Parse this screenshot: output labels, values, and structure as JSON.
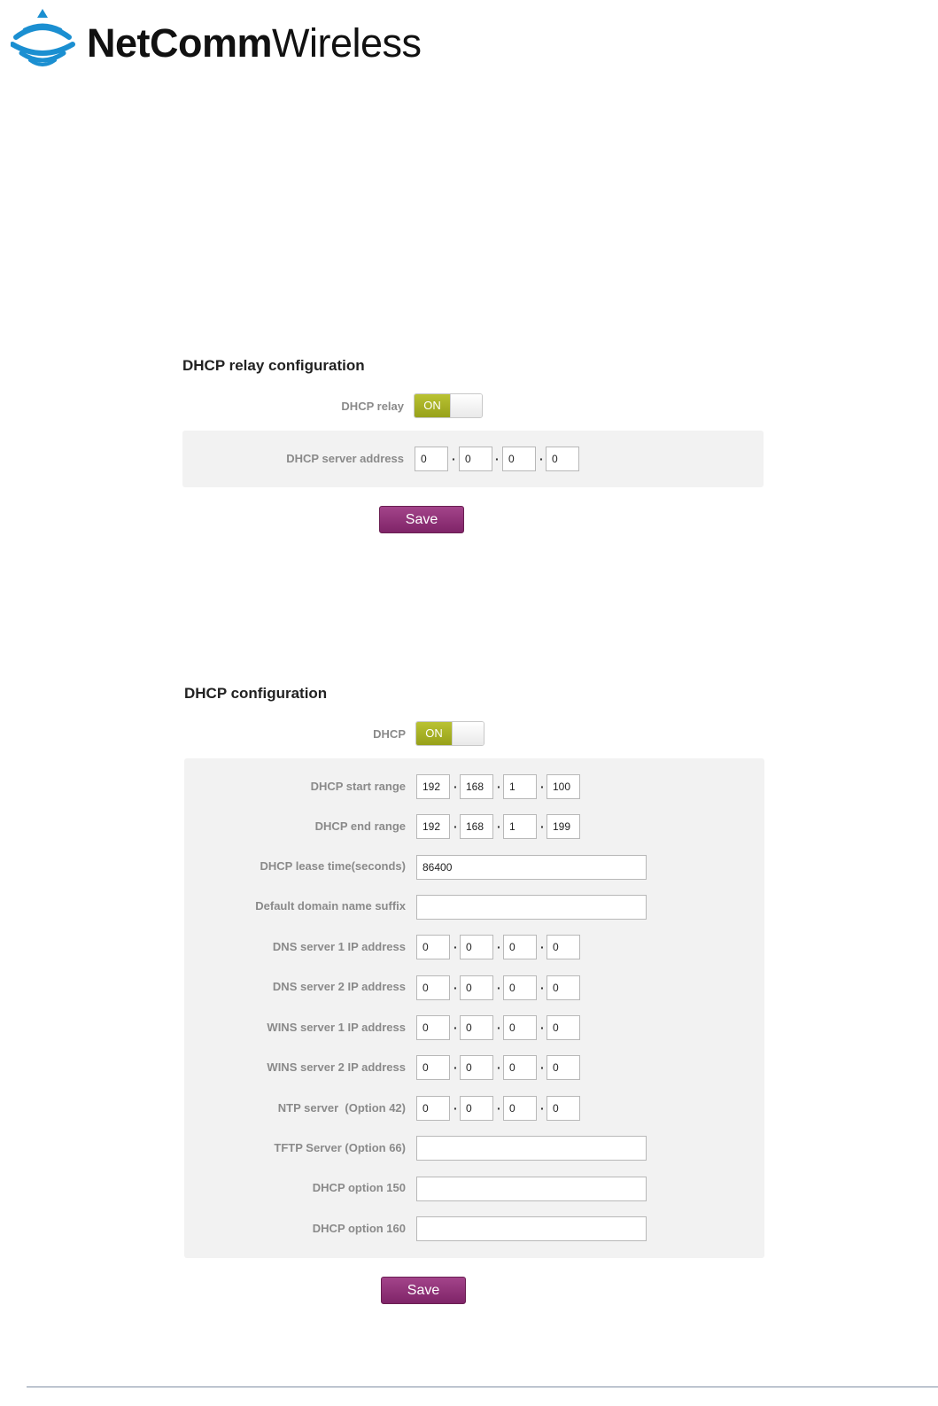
{
  "brand": {
    "name_bold": "NetComm",
    "name_light": "Wireless"
  },
  "relay": {
    "title": "DHCP relay configuration",
    "toggle_label": "DHCP relay",
    "toggle_state": "ON",
    "server_label": "DHCP server address",
    "server_ip": [
      "0",
      "0",
      "0",
      "0"
    ],
    "save_label": "Save"
  },
  "dhcp": {
    "title": "DHCP configuration",
    "toggle_label": "DHCP",
    "toggle_state": "ON",
    "start_label": "DHCP start range",
    "start_ip": [
      "192",
      "168",
      "1",
      "100"
    ],
    "end_label": "DHCP end range",
    "end_ip": [
      "192",
      "168",
      "1",
      "199"
    ],
    "lease_label": "DHCP lease time(seconds)",
    "lease_value": "86400",
    "domain_label": "Default domain name suffix",
    "domain_value": "",
    "dns1_label": "DNS server 1 IP address",
    "dns1_ip": [
      "0",
      "0",
      "0",
      "0"
    ],
    "dns2_label": "DNS server 2 IP address",
    "dns2_ip": [
      "0",
      "0",
      "0",
      "0"
    ],
    "wins1_label": "WINS server 1 IP address",
    "wins1_ip": [
      "0",
      "0",
      "0",
      "0"
    ],
    "wins2_label": "WINS server 2 IP address",
    "wins2_ip": [
      "0",
      "0",
      "0",
      "0"
    ],
    "ntp_label": "NTP server  (Option 42)",
    "ntp_ip": [
      "0",
      "0",
      "0",
      "0"
    ],
    "tftp_label": "TFTP Server (Option 66)",
    "tftp_value": "",
    "opt150_label": "DHCP option 150",
    "opt150_value": "",
    "opt160_label": "DHCP option 160",
    "opt160_value": "",
    "save_label": "Save"
  },
  "colors": {
    "accent": "#8e2f78",
    "toggle_on": "#a9b224",
    "panel": "#f2f2f2"
  },
  "icons": {
    "logo": "wifi-tower-logo-icon"
  }
}
